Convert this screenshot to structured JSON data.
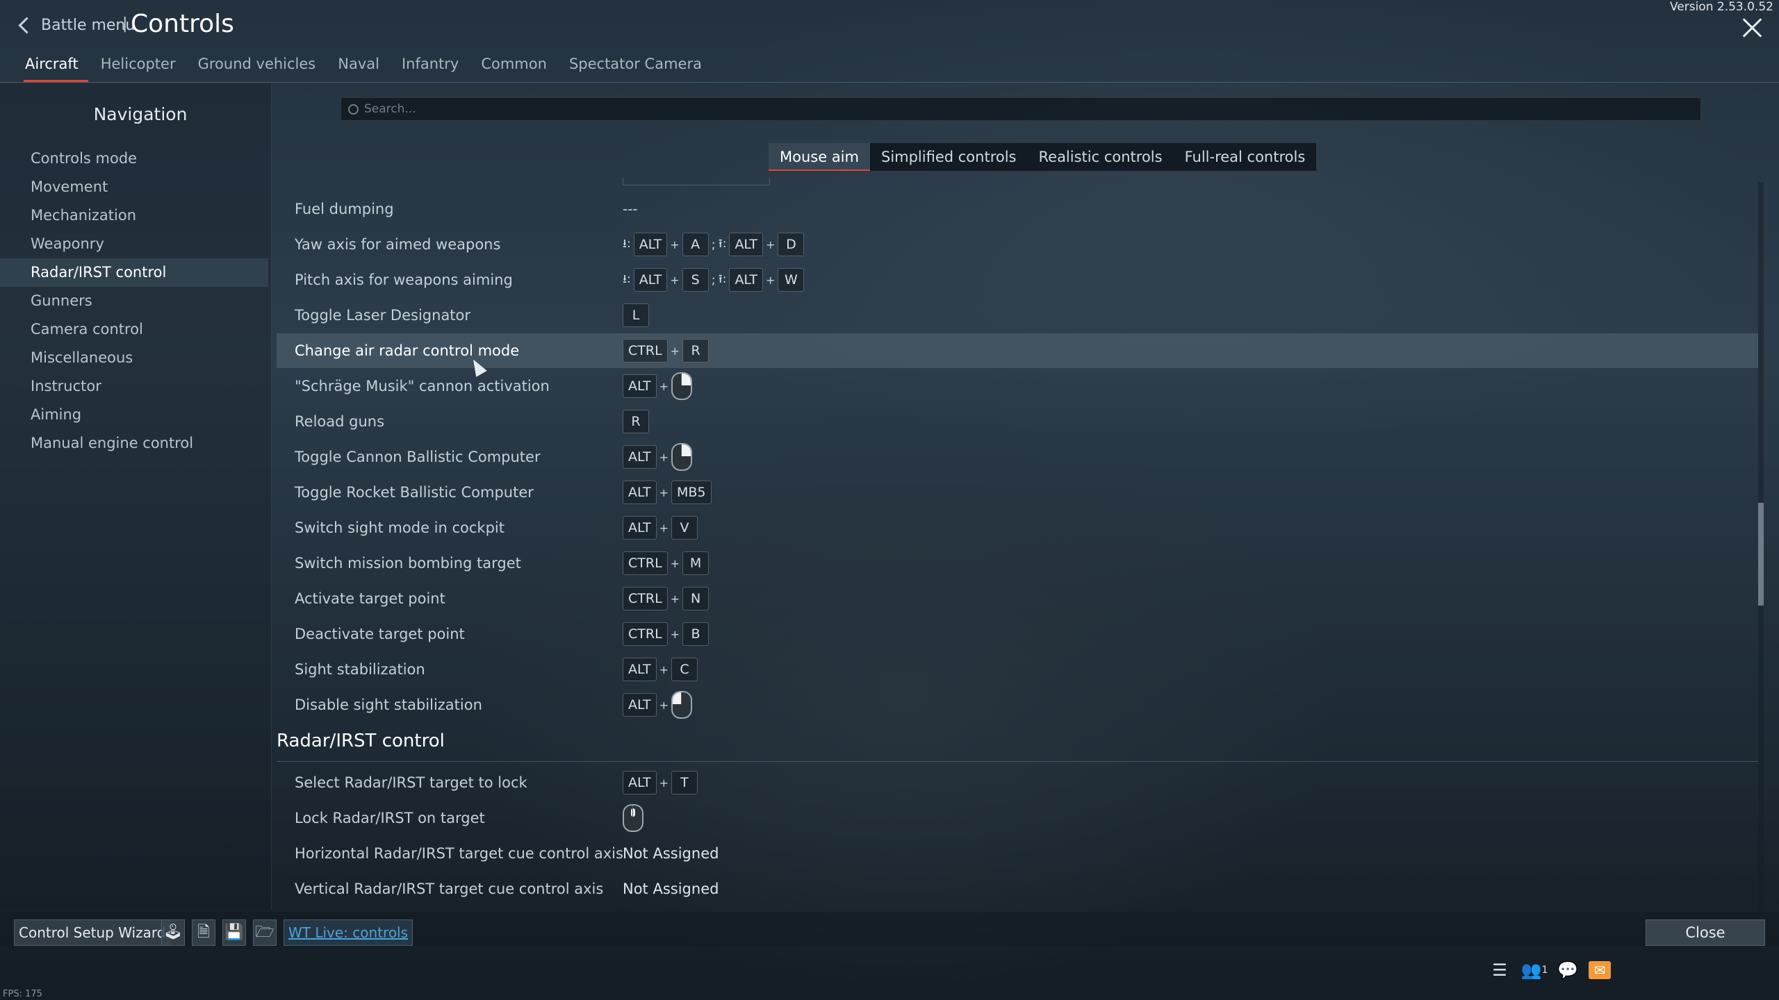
{
  "header": {
    "version": "Version 2.53.0.52",
    "back_label": "Battle menu",
    "separator": "|",
    "title": "Controls"
  },
  "tabs": [
    {
      "label": "Aircraft",
      "active": true
    },
    {
      "label": "Helicopter"
    },
    {
      "label": "Ground vehicles"
    },
    {
      "label": "Naval"
    },
    {
      "label": "Infantry"
    },
    {
      "label": "Common"
    },
    {
      "label": "Spectator Camera"
    }
  ],
  "sidebar": {
    "title": "Navigation",
    "items": [
      {
        "label": "Controls mode"
      },
      {
        "label": "Movement"
      },
      {
        "label": "Mechanization"
      },
      {
        "label": "Weaponry"
      },
      {
        "label": "Radar/IRST control",
        "active": true
      },
      {
        "label": "Gunners"
      },
      {
        "label": "Camera control"
      },
      {
        "label": "Miscellaneous"
      },
      {
        "label": "Instructor"
      },
      {
        "label": "Aiming"
      },
      {
        "label": "Manual engine control"
      }
    ]
  },
  "search": {
    "placeholder": "Search..."
  },
  "modes": [
    {
      "label": "Mouse aim",
      "active": true
    },
    {
      "label": "Simplified controls"
    },
    {
      "label": "Realistic controls"
    },
    {
      "label": "Full-real controls"
    }
  ],
  "rows": [
    {
      "label": "Fuel dumping",
      "binding": "---"
    },
    {
      "label": "Yaw axis for aimed weapons",
      "axis": [
        "ALT",
        "A",
        "ALT",
        "D"
      ]
    },
    {
      "label": "Pitch axis for weapons aiming",
      "axis": [
        "ALT",
        "S",
        "ALT",
        "W"
      ]
    },
    {
      "label": "Toggle Laser Designator",
      "keys": [
        "L"
      ]
    },
    {
      "label": "Change air radar control mode",
      "keys": [
        "CTRL",
        "R"
      ],
      "highlighted": true
    },
    {
      "label": "\"Schräge Musik\" cannon activation",
      "keys": [
        "ALT"
      ],
      "mouse": "right"
    },
    {
      "label": "Reload guns",
      "keys": [
        "R"
      ]
    },
    {
      "label": "Toggle Cannon Ballistic Computer",
      "keys": [
        "ALT"
      ],
      "mouse": "right"
    },
    {
      "label": "Toggle Rocket Ballistic Computer",
      "keys": [
        "ALT",
        "MB5"
      ]
    },
    {
      "label": "Switch sight mode in cockpit",
      "keys": [
        "ALT",
        "V"
      ]
    },
    {
      "label": "Switch mission bombing target",
      "keys": [
        "CTRL",
        "M"
      ]
    },
    {
      "label": "Activate target point",
      "keys": [
        "CTRL",
        "N"
      ]
    },
    {
      "label": "Deactivate target point",
      "keys": [
        "CTRL",
        "B"
      ]
    },
    {
      "label": "Sight stabilization",
      "keys": [
        "ALT",
        "C"
      ]
    },
    {
      "label": "Disable sight stabilization",
      "keys": [
        "ALT"
      ],
      "mouse": "left"
    }
  ],
  "section": {
    "title": "Radar/IRST control",
    "rows": [
      {
        "label": "Select Radar/IRST target to lock",
        "keys": [
          "ALT",
          "T"
        ]
      },
      {
        "label": "Lock Radar/IRST on target",
        "mouse": "mid"
      },
      {
        "label": "Horizontal Radar/IRST target cue control axis",
        "binding": "Not Assigned"
      },
      {
        "label": "Vertical Radar/IRST target cue control axis",
        "binding": "Not Assigned"
      }
    ]
  },
  "bottom": {
    "wizard_label": "Control Setup Wizard",
    "wtlive_label": "WT Live: controls",
    "close_label": "Close",
    "icons": [
      "joystick-icon",
      "document-icon",
      "save-icon",
      "folder-icon"
    ]
  },
  "tray": {
    "squad_count": "1"
  },
  "fps": "FPS: 175",
  "colors": {
    "accent": "#d9483b",
    "link": "#4ea3d6",
    "mail": "#f29a3a"
  }
}
